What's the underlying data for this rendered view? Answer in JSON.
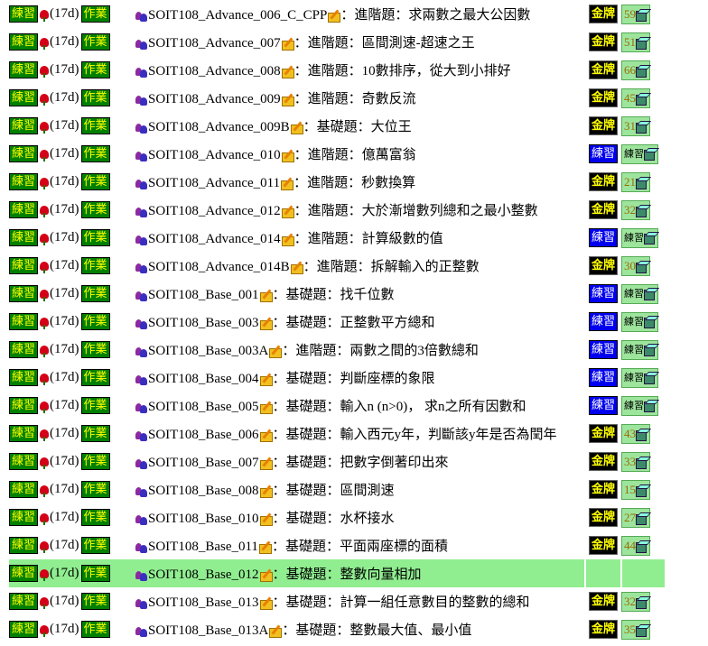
{
  "labels": {
    "practice": "練習",
    "homework": "作業",
    "days": "(17d)",
    "gold": "金牌",
    "practice_badge": "練習"
  },
  "rows": [
    {
      "id": "SOIT108_Advance_006_C_CPP",
      "title": "：進階題：求兩數之最大公因數",
      "badge": "gold",
      "count": "59"
    },
    {
      "id": "SOIT108_Advance_007",
      "title": "：進階題：區間測速-超速之王",
      "badge": "gold",
      "count": "51"
    },
    {
      "id": "SOIT108_Advance_008",
      "title": "：進階題：10數排序，從大到小排好",
      "badge": "gold",
      "count": "66"
    },
    {
      "id": "SOIT108_Advance_009",
      "title": "：進階題：奇數反流",
      "badge": "gold",
      "count": "45"
    },
    {
      "id": "SOIT108_Advance_009B",
      "title": "：基礎題：大位王",
      "badge": "gold",
      "count": "31"
    },
    {
      "id": "SOIT108_Advance_010",
      "title": "：進階題：億萬富翁",
      "badge": "practice",
      "count": "練習"
    },
    {
      "id": "SOIT108_Advance_011",
      "title": "：進階題：秒數換算",
      "badge": "gold",
      "count": "21"
    },
    {
      "id": "SOIT108_Advance_012",
      "title": "：進階題：大於漸增數列總和之最小整數",
      "badge": "gold",
      "count": "32"
    },
    {
      "id": "SOIT108_Advance_014",
      "title": "：進階題：計算級數的值",
      "badge": "practice",
      "count": "練習"
    },
    {
      "id": "SOIT108_Advance_014B",
      "title": "：進階題：拆解輸入的正整數",
      "badge": "gold",
      "count": "30"
    },
    {
      "id": "SOIT108_Base_001",
      "title": "：基礎題：找千位數",
      "badge": "practice",
      "count": "練習"
    },
    {
      "id": "SOIT108_Base_003",
      "title": "：基礎題：正整數平方總和",
      "badge": "practice",
      "count": "練習"
    },
    {
      "id": "SOIT108_Base_003A",
      "title": "：進階題：兩數之間的3倍數總和",
      "badge": "practice",
      "count": "練習"
    },
    {
      "id": "SOIT108_Base_004",
      "title": "：基礎題：判斷座標的象限",
      "badge": "practice",
      "count": "練習"
    },
    {
      "id": "SOIT108_Base_005",
      "title": "：基礎題：輸入n (n>0)， 求n之所有因數和",
      "badge": "practice",
      "count": "練習"
    },
    {
      "id": "SOIT108_Base_006",
      "title": "：基礎題：輸入西元y年，判斷該y年是否為閏年",
      "badge": "gold",
      "count": "43"
    },
    {
      "id": "SOIT108_Base_007",
      "title": "：基礎題：把數字倒著印出來",
      "badge": "gold",
      "count": "33"
    },
    {
      "id": "SOIT108_Base_008",
      "title": "：基礎題：區間測速",
      "badge": "gold",
      "count": "15"
    },
    {
      "id": "SOIT108_Base_010",
      "title": "：基礎題：水杯接水",
      "badge": "gold",
      "count": "27"
    },
    {
      "id": "SOIT108_Base_011",
      "title": "：基礎題：平面兩座標的面積",
      "badge": "gold",
      "count": "44"
    },
    {
      "id": "SOIT108_Base_012",
      "title": "：基礎題：整數向量相加",
      "badge": "none",
      "count": "",
      "highlight": true
    },
    {
      "id": "SOIT108_Base_013",
      "title": "：基礎題：計算一組任意數目的整數的總和",
      "badge": "gold",
      "count": "32"
    },
    {
      "id": "SOIT108_Base_013A",
      "title": "：基礎題：整數最大值、最小值",
      "badge": "gold",
      "count": "35"
    }
  ]
}
